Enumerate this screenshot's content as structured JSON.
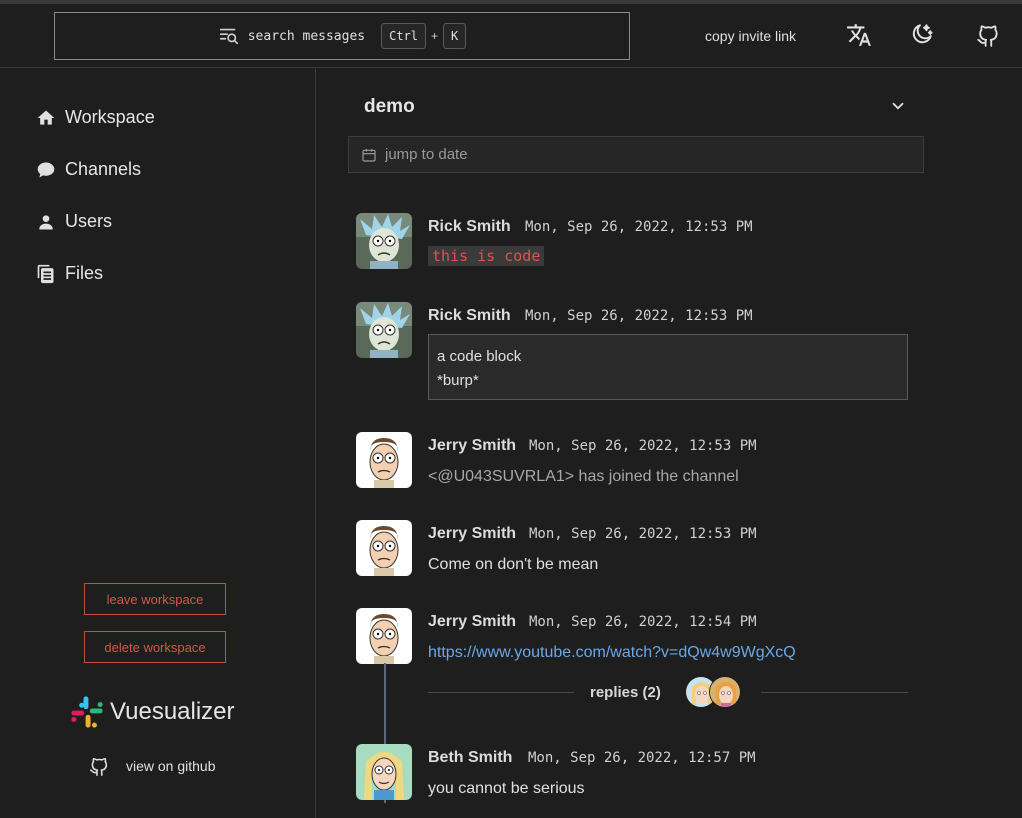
{
  "header": {
    "search_label": "search messages",
    "shortcut_key1": "Ctrl",
    "shortcut_plus": "+",
    "shortcut_key2": "K",
    "copy_invite": "copy invite link",
    "icons": [
      "search-list-icon",
      "translate-icon",
      "moon-stars-icon",
      "github-icon"
    ]
  },
  "sidebar": {
    "items": [
      {
        "label": "Workspace",
        "icon": "home-icon"
      },
      {
        "label": "Channels",
        "icon": "chat-bubble-icon"
      },
      {
        "label": "Users",
        "icon": "user-icon"
      },
      {
        "label": "Files",
        "icon": "files-icon"
      }
    ],
    "leave_label": "leave workspace",
    "delete_label": "delete workspace",
    "brand_name": "Vuesualizer",
    "github_link": "view on github"
  },
  "channel": {
    "name": "demo",
    "date_placeholder": "jump to date"
  },
  "messages": [
    {
      "author": "Rick Smith",
      "time": "Mon, Sep 26, 2022, 12:53 PM",
      "inline_code": "this is code"
    },
    {
      "author": "Rick Smith",
      "time": "Mon, Sep 26, 2022, 12:53 PM",
      "code_block": "a code block\n*burp*"
    },
    {
      "author": "Jerry Smith",
      "time": "Mon, Sep 26, 2022, 12:53 PM",
      "text": "<@U043SUVRLA1> has joined the channel"
    },
    {
      "author": "Jerry Smith",
      "time": "Mon, Sep 26, 2022, 12:53 PM",
      "text": "Come on don't be mean"
    },
    {
      "author": "Jerry Smith",
      "time": "Mon, Sep 26, 2022, 12:54 PM",
      "link": "https://www.youtube.com/watch?v=dQw4w9WgXcQ",
      "replies_label": "replies (2)"
    },
    {
      "author": "Beth Smith",
      "time": "Mon, Sep 26, 2022, 12:57 PM",
      "text": "you cannot be serious"
    }
  ],
  "colors": {
    "background": "#1e1e1e",
    "danger": "#d05a44",
    "link": "#6aa8e8",
    "inline_code": "#e05050"
  }
}
